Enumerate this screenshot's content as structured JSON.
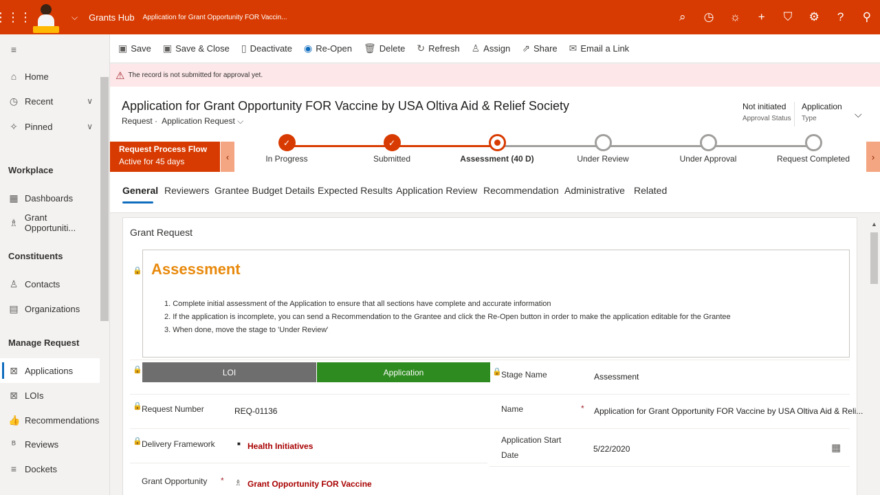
{
  "topbar": {
    "app_name": "Grants Hub",
    "record_crumb": "Application for Grant Opportunity FOR Vaccin...",
    "icons": [
      "search-icon",
      "task-icon",
      "lightbulb-icon",
      "plus-icon",
      "filter-icon",
      "gear-icon",
      "help-icon",
      "user-icon"
    ]
  },
  "sidebar": {
    "home": "Home",
    "recent": "Recent",
    "pinned": "Pinned",
    "workplace": "Workplace",
    "dashboards": "Dashboards",
    "grant_opportunities": "Grant Opportuniti...",
    "constituents": "Constituents",
    "contacts": "Contacts",
    "organizations": "Organizations",
    "manage_request": "Manage Request",
    "applications": "Applications",
    "lois": "LOIs",
    "recommendations": "Recommendations",
    "reviews": "Reviews",
    "dockets": "Dockets"
  },
  "commands": {
    "save": "Save",
    "save_close": "Save & Close",
    "deactivate": "Deactivate",
    "reopen": "Re-Open",
    "delete": "Delete",
    "refresh": "Refresh",
    "assign": "Assign",
    "share": "Share",
    "email_link": "Email a Link"
  },
  "notice": "The record is not submitted for approval yet.",
  "header": {
    "title": "Application for Grant Opportunity FOR Vaccine by USA Oltiva Aid & Relief Society",
    "entity": "Request",
    "separator": "·",
    "form": "Application Request",
    "approval_status_value": "Not initiated",
    "approval_status_label": "Approval Status",
    "type_value": "Application",
    "type_label": "Type"
  },
  "bpf": {
    "name": "Request Process Flow",
    "duration": "Active for 45 days",
    "stages": [
      {
        "name": "In Progress",
        "state": "done"
      },
      {
        "name": "Submitted",
        "state": "done"
      },
      {
        "name": "Assessment  (40 D)",
        "state": "active"
      },
      {
        "name": "Under Review",
        "state": "todo"
      },
      {
        "name": "Under Approval",
        "state": "todo"
      },
      {
        "name": "Request Completed",
        "state": "todo"
      }
    ]
  },
  "tabs": [
    "General",
    "Reviewers",
    "Grantee Budget Details",
    "Expected Results",
    "Application Review",
    "Recommendation",
    "Administrative",
    "Related"
  ],
  "form": {
    "section_title": "Grant Request",
    "assessment_title": "Assessment",
    "instructions": [
      "1. Complete initial assessment of the Application to ensure that all sections have complete and accurate information",
      "2. If the application is incomplete, you can send a Recommendation to the Grantee and click the Re-Open button in order to make the application editable for the Grantee",
      "3. When done, move the stage to 'Under Review'"
    ],
    "stagebar_loi": "LOI",
    "stagebar_application": "Application",
    "stage_name_label": "Stage Name",
    "stage_name_value": "Assessment",
    "request_number_label": "Request Number",
    "request_number_value": "REQ-01136",
    "name_label": "Name",
    "name_value": "Application for Grant Opportunity FOR Vaccine by USA Oltiva Aid & Reli...",
    "delivery_label": "Delivery Framework",
    "delivery_value": "Health Initiatives",
    "start_date_label_1": "Application Start",
    "start_date_label_2": "Date",
    "start_date_value": "5/22/2020",
    "grant_opp_label": "Grant Opportunity",
    "grant_opp_value": "Grant Opportunity FOR Vaccine",
    "required_mark": "*"
  },
  "colors": {
    "brand": "#d83b01",
    "stage_loi": "#6e6e6e",
    "stage_application": "#2e8b1f",
    "assessment_title": "#e8890c"
  }
}
